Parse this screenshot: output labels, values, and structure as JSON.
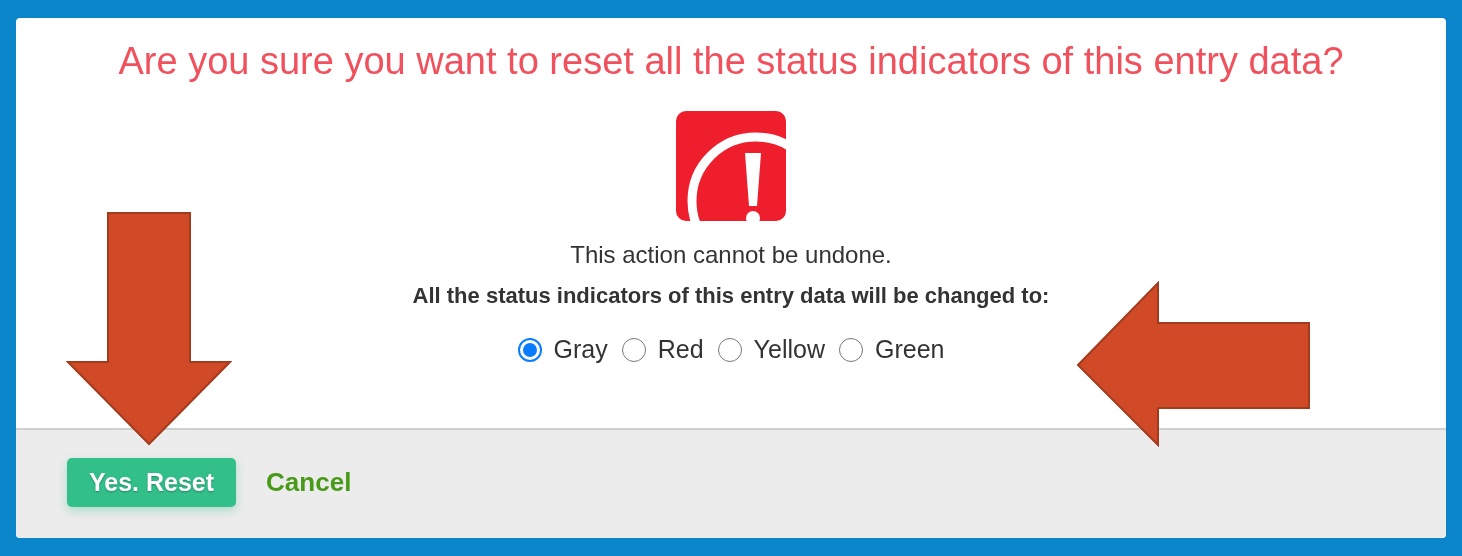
{
  "dialog": {
    "title": "Are you sure you want to reset all the status indicators of this entry data?",
    "message": "This action cannot be undone.",
    "instruction": "All the status indicators of this entry data will be changed to:",
    "options": [
      {
        "label": "Gray",
        "selected": true
      },
      {
        "label": "Red",
        "selected": false
      },
      {
        "label": "Yellow",
        "selected": false
      },
      {
        "label": "Green",
        "selected": false
      }
    ],
    "buttons": [
      {
        "label": "Yes. Reset",
        "kind": "primary"
      },
      {
        "label": "Cancel",
        "kind": "link"
      }
    ]
  }
}
